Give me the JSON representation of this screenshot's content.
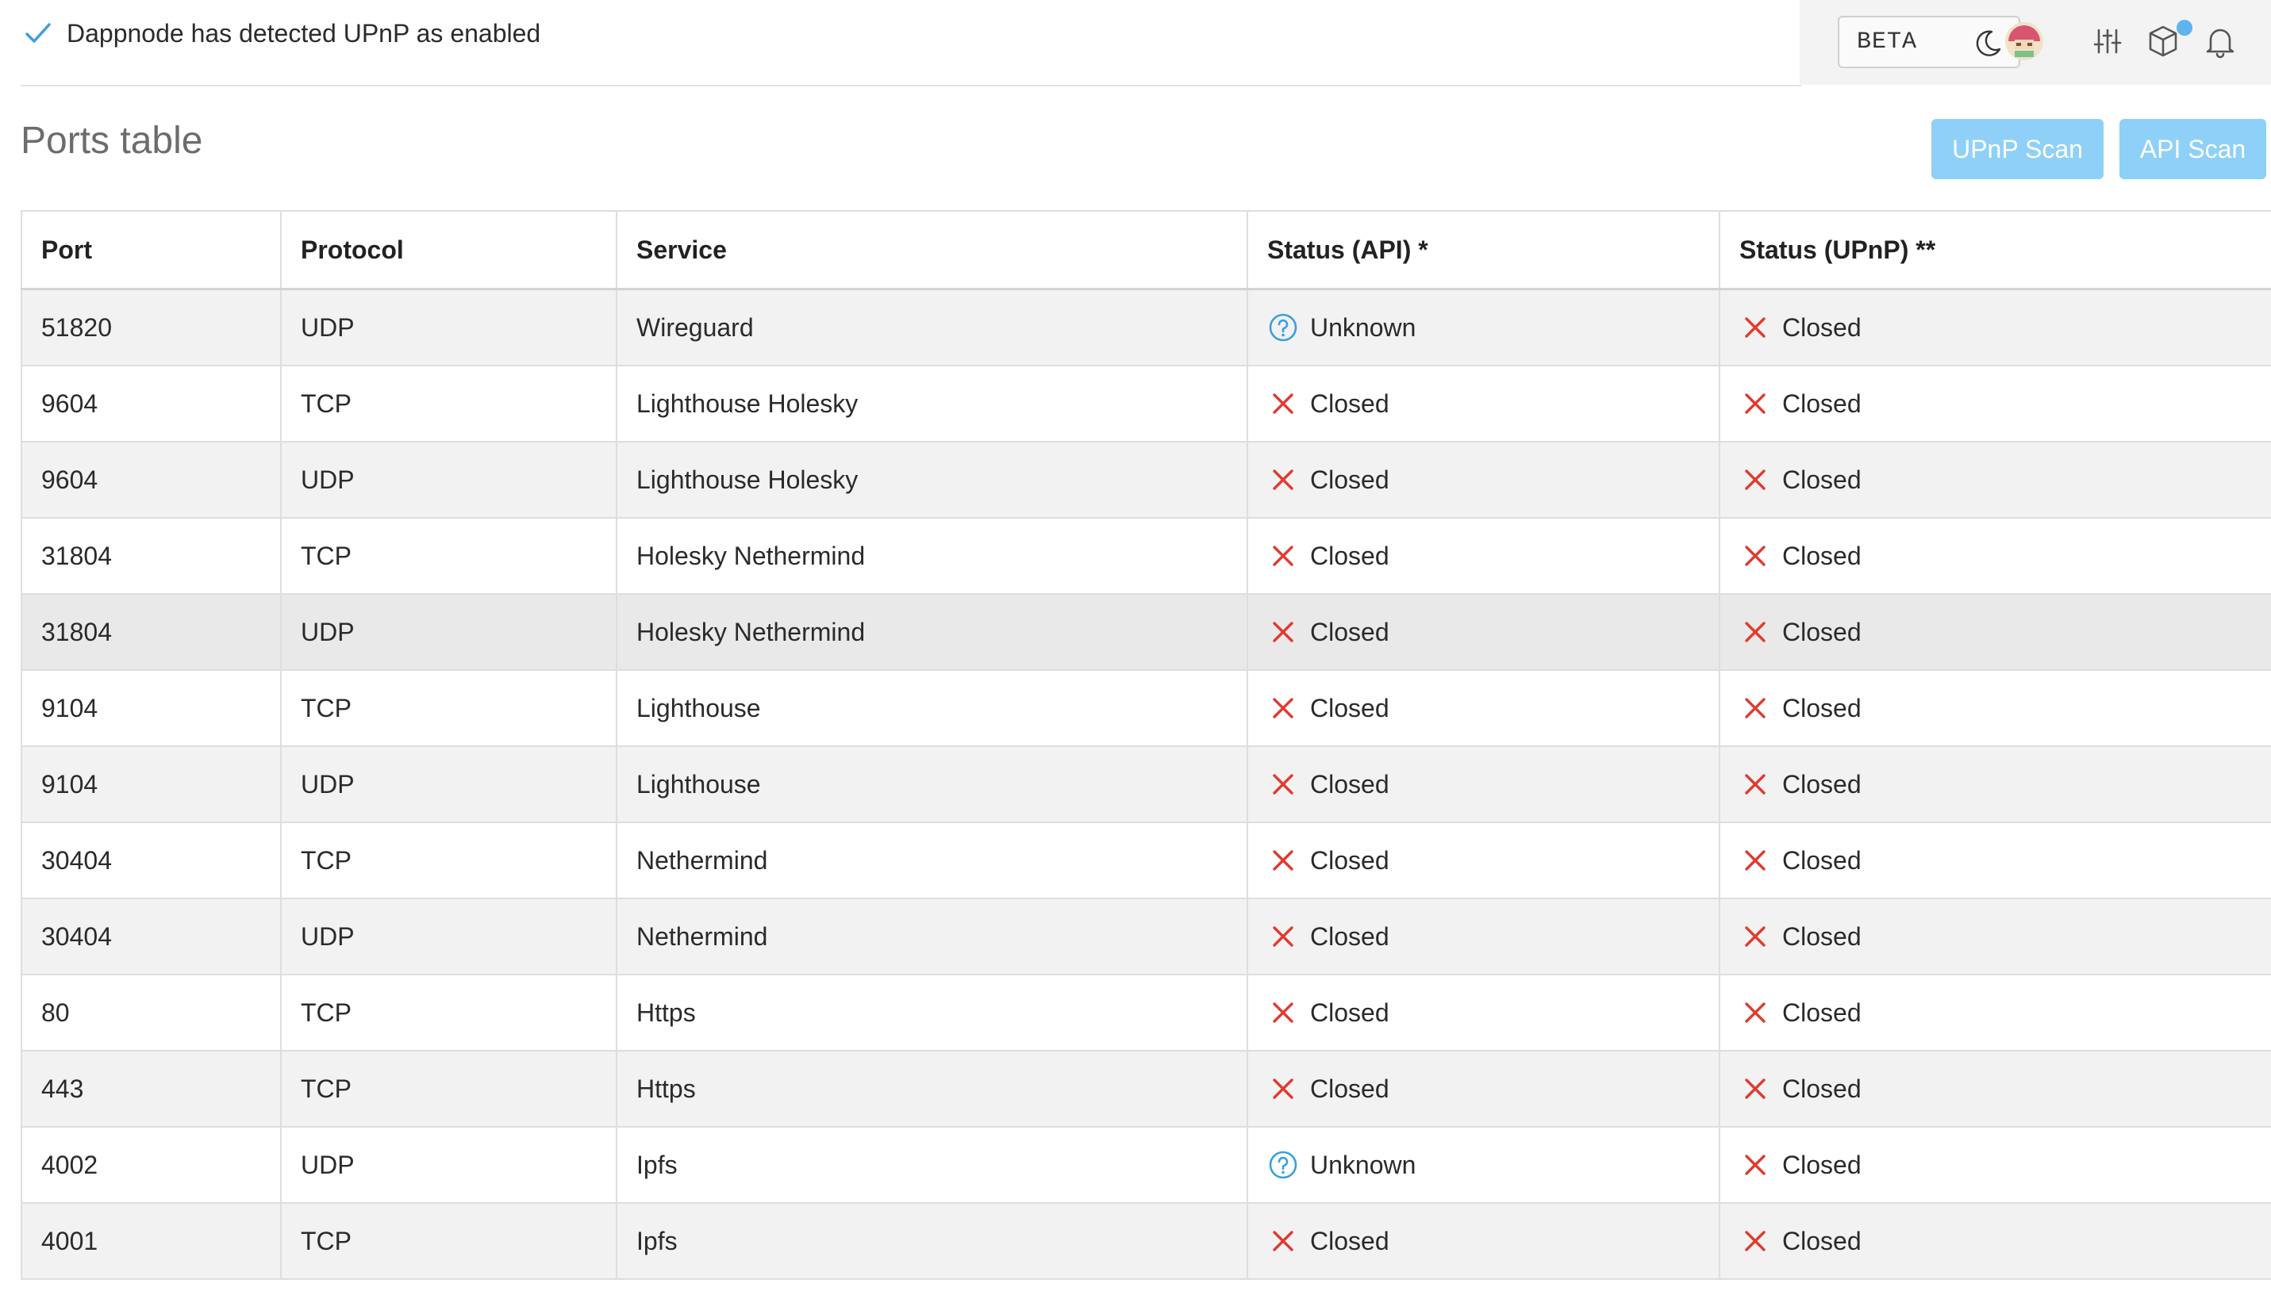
{
  "notice": {
    "text": "Dappnode has detected UPnP as enabled"
  },
  "toolbar": {
    "beta_label": "BETA",
    "icons": [
      "moon-icon",
      "avatar",
      "sliders-icon",
      "cube-icon",
      "bell-icon"
    ],
    "badge_color": "#5fb4f0"
  },
  "title": "Ports table",
  "buttons": {
    "upnp_scan": "UPnP Scan",
    "api_scan": "API Scan",
    "color": "#8fd0f8"
  },
  "table": {
    "headers": [
      "Port",
      "Protocol",
      "Service",
      "Status (API) *",
      "Status (UPnP) **"
    ],
    "rows": [
      {
        "port": "51820",
        "protocol": "UDP",
        "service": "Wireguard",
        "api": "Unknown",
        "upnp": "Closed"
      },
      {
        "port": "9604",
        "protocol": "TCP",
        "service": "Lighthouse Holesky",
        "api": "Closed",
        "upnp": "Closed"
      },
      {
        "port": "9604",
        "protocol": "UDP",
        "service": "Lighthouse Holesky",
        "api": "Closed",
        "upnp": "Closed"
      },
      {
        "port": "31804",
        "protocol": "TCP",
        "service": "Holesky Nethermind",
        "api": "Closed",
        "upnp": "Closed"
      },
      {
        "port": "31804",
        "protocol": "UDP",
        "service": "Holesky Nethermind",
        "api": "Closed",
        "upnp": "Closed"
      },
      {
        "port": "9104",
        "protocol": "TCP",
        "service": "Lighthouse",
        "api": "Closed",
        "upnp": "Closed"
      },
      {
        "port": "9104",
        "protocol": "UDP",
        "service": "Lighthouse",
        "api": "Closed",
        "upnp": "Closed"
      },
      {
        "port": "30404",
        "protocol": "TCP",
        "service": "Nethermind",
        "api": "Closed",
        "upnp": "Closed"
      },
      {
        "port": "30404",
        "protocol": "UDP",
        "service": "Nethermind",
        "api": "Closed",
        "upnp": "Closed"
      },
      {
        "port": "80",
        "protocol": "TCP",
        "service": "Https",
        "api": "Closed",
        "upnp": "Closed"
      },
      {
        "port": "443",
        "protocol": "TCP",
        "service": "Https",
        "api": "Closed",
        "upnp": "Closed"
      },
      {
        "port": "4002",
        "protocol": "UDP",
        "service": "Ipfs",
        "api": "Unknown",
        "upnp": "Closed"
      },
      {
        "port": "4001",
        "protocol": "TCP",
        "service": "Ipfs",
        "api": "Closed",
        "upnp": "Closed"
      }
    ]
  },
  "status_colors": {
    "closed": "#e03a2f",
    "unknown": "#3a9fe0",
    "check": "#3a9fe0"
  }
}
